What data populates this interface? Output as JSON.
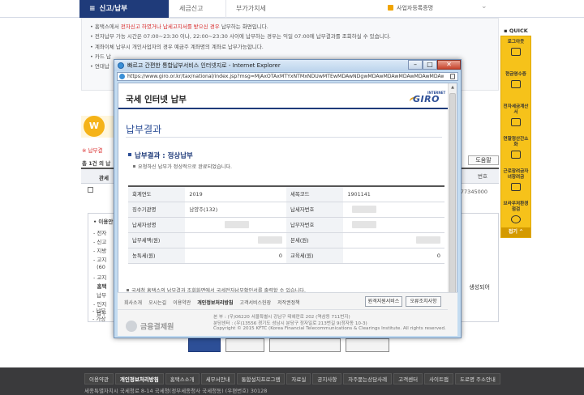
{
  "page": {
    "menu_label": "신고/납부",
    "tabs": [
      "세금신고",
      "부가가치세"
    ],
    "cert_label": "사업자등록증명",
    "notice_lines": [
      "홈택스에서 전자신고 하였거나 납세고지서를 받으신 경우 납부하는 화면입니다.",
      "전자납부 가능 시간은 07:00~23:30 이나, 22:00~23:30 사이에 납부하는 경우는 익일 07:00에 납부결과를 조회하실 수 있습니다.",
      "계좌이체 납부시 개인사업자의 경우 예금주 계좌명의 계좌로 납부가능합니다.",
      "카드 납",
      "연대납"
    ],
    "notice_red": "전자신고 하였거나 납세고지서를 받으신 경우",
    "left_label_1": "※ 납부결",
    "left_label_2": "총 1건 의 납",
    "col_header": "관세",
    "help_button": "도움말",
    "right_col_header": "번호",
    "right_number": "77345000",
    "list_title": "이용안",
    "list_lines": [
      "전자",
      "신고",
      "지방",
      "고지",
      "(60",
      "고지",
      "홈택",
      "납부",
      "인지",
      "납부",
      "납부",
      "가상"
    ],
    "list_ext": "생성되어",
    "footer_links": [
      "이용약관",
      "개인정보처리방침",
      "홈택스소개",
      "세무서안내",
      "통합설치프로그램",
      "자료실",
      "공지사항",
      "자주묻는상담사례",
      "고객센터",
      "사이트맵",
      "도로명 주소안내"
    ],
    "footer_addr": "세종특별자치시 국세청로 8-14 국세청(정부세종청사 국세청동) (우편번호) 30128"
  },
  "quick": {
    "title": "QUICK",
    "items": [
      "로그아웃",
      "현금영수증",
      "전자세금계산서",
      "연말정산간소화",
      "근로장려금자녀장려금",
      "브라우저환경점검"
    ],
    "foot": "접기 ^"
  },
  "popup": {
    "window_title": "빠르고 간편한 통합납부서비스 인터넷지로 - Internet Explorer",
    "url": "https://www.giro.or.kr/tax/national/index.jsp?msg=MjAxOTAxMTYxNTMxNDUwMTEwMDAwNDgwMDAwMDAwMDAwMDAwMDAwMDAwMDAwMHNhb",
    "header_title": "국세 인터넷 납부",
    "logo_small": "INTERNET",
    "logo_big": "GIRO",
    "section_title": "납부결과",
    "result_heading": "납부결과 : 정상납부",
    "result_note": "요청하신 납부가 정상적으로 완료되었습니다.",
    "table": {
      "r1": {
        "l1": "회계연도",
        "v1": "2019",
        "l2": "세목코드",
        "v2": "1901141"
      },
      "r2": {
        "l1": "징수기관명",
        "v1": "남양주(132)",
        "l2": "납세자번호"
      },
      "r3": {
        "l1": "납세자성명",
        "l2": "납부자번호"
      },
      "r4": {
        "l1": "납부세액(원)",
        "l2": "본세(원)"
      },
      "r5": {
        "l1": "농특세(원)",
        "v1": "0",
        "l2": "교육세(원)",
        "v2": "0"
      }
    },
    "bottom_note": "국세청 홈택스의 납부결과 조회화면에서 국세전자납부확인서를 출력할 수 있습니다.",
    "btn_remote": "원격지원서비스",
    "btn_error": "오류조치사항",
    "footer_links": [
      "회사소개",
      "오시는길",
      "이용약관",
      "개인정보처리방침",
      "고객서비스헌장",
      "저작권정책"
    ],
    "kftc_name": "금융결제원",
    "kftc_lines": [
      "본  부 : (우)06220 서울특별시 강남구 테헤란로 202 (역삼동 711번지)",
      "분당센터 : (우)13556 경기도 성남시 분당구 정자일로 213번길 9(정자동 10-3)",
      "Copyright © 2015 KFTC (Korea Financial Telecommunications & Clearings Institute. All rights reserved."
    ]
  }
}
